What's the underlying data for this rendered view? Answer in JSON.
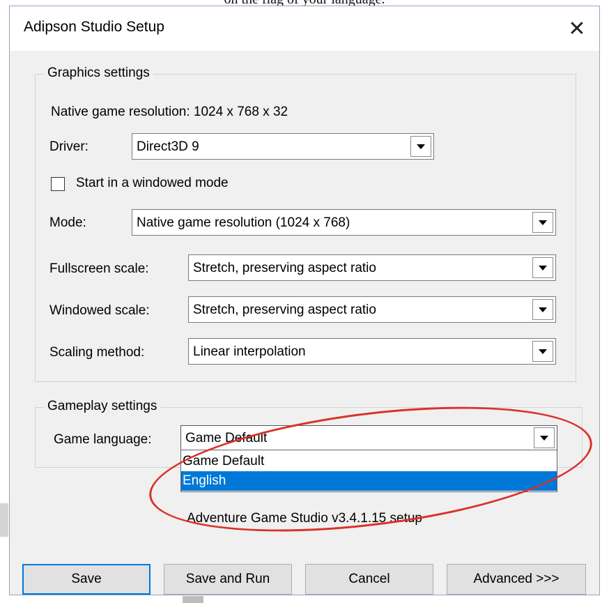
{
  "page_caption": "on the flag of your language.",
  "window": {
    "title": "Adipson Studio Setup",
    "close_glyph": "✕"
  },
  "graphics": {
    "group_label": "Graphics settings",
    "native_resolution": "Native game resolution: 1024 x 768 x 32",
    "driver_label": "Driver:",
    "driver_value": "Direct3D 9",
    "windowed_label": "Start in a windowed mode",
    "windowed_checked": false,
    "mode_label": "Mode:",
    "mode_value": "Native game resolution (1024 x 768)",
    "fullscreen_scale_label": "Fullscreen scale:",
    "fullscreen_scale_value": "Stretch, preserving aspect ratio",
    "windowed_scale_label": "Windowed scale:",
    "windowed_scale_value": "Stretch, preserving aspect ratio",
    "scaling_method_label": "Scaling method:",
    "scaling_method_value": "Linear interpolation"
  },
  "gameplay": {
    "group_label": "Gameplay settings",
    "language_label": "Game language:",
    "language_value": "Game Default",
    "language_options": [
      "Game Default",
      "English"
    ],
    "highlighted_option": "English"
  },
  "version_text": "Adventure Game Studio v3.4.1.15 setup",
  "buttons": {
    "save": "Save",
    "save_and_run": "Save and Run",
    "cancel": "Cancel",
    "advanced": "Advanced >>>"
  },
  "colors": {
    "highlight": "#0078d7",
    "annotation": "#d9322b",
    "dialog_bg": "#f0f0f0"
  }
}
